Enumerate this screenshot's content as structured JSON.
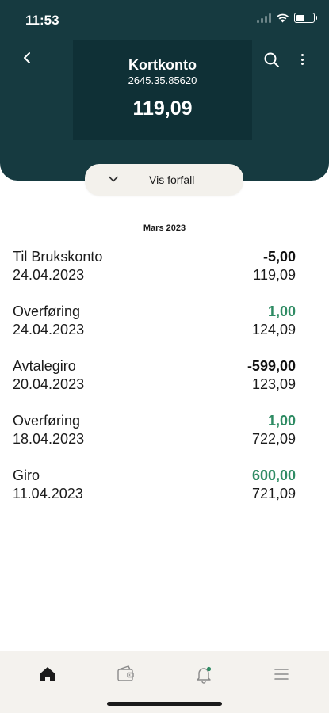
{
  "status": {
    "time": "11:53"
  },
  "account": {
    "name": "Kortkonto",
    "number": "2645.35.85620",
    "balance": "119,09"
  },
  "actions": {
    "vis_forfall": "Vis forfall"
  },
  "month": "Mars 2023",
  "colors": {
    "header": "#163a40",
    "positive": "#2e8b63",
    "negative": "#111111"
  },
  "transactions": [
    {
      "name": "Til Brukskonto",
      "date": "24.04.2023",
      "amount": "-5,00",
      "balance": "119,09",
      "positive": false
    },
    {
      "name": "Overføring",
      "date": "24.04.2023",
      "amount": "1,00",
      "balance": "124,09",
      "positive": true
    },
    {
      "name": "Avtalegiro",
      "date": "20.04.2023",
      "amount": "-599,00",
      "balance": "123,09",
      "positive": false
    },
    {
      "name": "Overføring",
      "date": "18.04.2023",
      "amount": "1,00",
      "balance": "722,09",
      "positive": true
    },
    {
      "name": "Giro",
      "date": "11.04.2023",
      "amount": "600,00",
      "balance": "721,09",
      "positive": true
    }
  ],
  "nav": [
    {
      "icon": "home-icon"
    },
    {
      "icon": "wallet-icon"
    },
    {
      "icon": "bell-icon"
    },
    {
      "icon": "menu-icon"
    }
  ]
}
